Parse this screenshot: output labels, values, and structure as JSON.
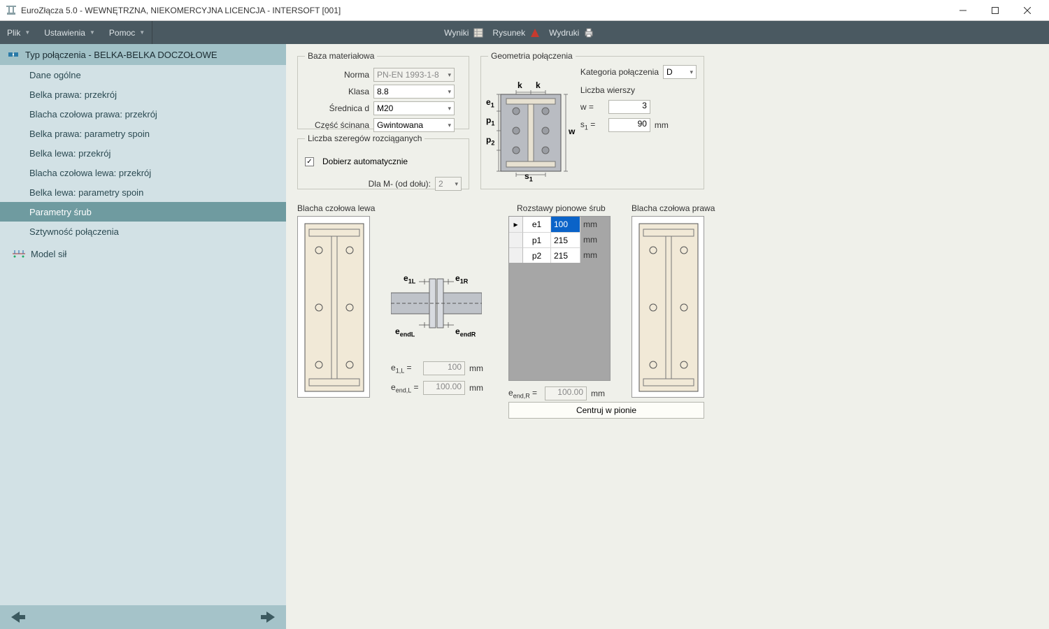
{
  "window": {
    "title": "EuroZłącza 5.0 - WEWNĘTRZNA, NIEKOMERCYJNA LICENCJA - INTERSOFT [001]"
  },
  "menu": {
    "plik": "Plik",
    "ustawienia": "Ustawienia",
    "pomoc": "Pomoc"
  },
  "toolbar": {
    "wyniki": "Wyniki",
    "rysunek": "Rysunek",
    "wydruki": "Wydruki"
  },
  "sidebar": {
    "header": "Typ połączenia - BELKA-BELKA DOCZOŁOWE",
    "items": [
      "Dane ogólne",
      "Belka prawa: przekrój",
      "Blacha czołowa prawa: przekrój",
      "Belka prawa: parametry spoin",
      "Belka lewa: przekrój",
      "Blacha czołowa lewa: przekrój",
      "Belka lewa: parametry spoin",
      "Parametry śrub",
      "Sztywność połączenia"
    ],
    "model": "Model sił"
  },
  "groups": {
    "baza": {
      "legend": "Baza materiałowa",
      "norma_lbl": "Norma",
      "norma_val": "PN-EN 1993-1-8",
      "klasa_lbl": "Klasa",
      "klasa_val": "8.8",
      "srednica_lbl": "Średnica d",
      "srednica_val": "M20",
      "czesc_lbl": "Część ścinana",
      "czesc_val": "Gwintowana"
    },
    "szeregi": {
      "legend": "Liczba szeregów rozciąganych",
      "auto_lbl": "Dobierz automatycznie",
      "dlam_lbl": "Dla M- (od dołu):",
      "dlam_val": "2"
    },
    "geom": {
      "legend": "Geometria połączenia",
      "kategoria_lbl": "Kategoria połączenia",
      "kategoria_val": "D",
      "wierszy_lbl": "Liczba  wierszy",
      "w_lbl": "w   =",
      "w_val": "3",
      "s1_lbl_pre": "s",
      "s1_lbl_post": "   =",
      "s1_val": "90",
      "s1_unit": "mm"
    }
  },
  "labels": {
    "blacha_lewa": "Blacha czołowa lewa",
    "blacha_prawa": "Blacha czołowa prawa",
    "rozstawy": "Rozstawy pionowe śrub",
    "centruj": "Centruj w pionie",
    "mm": "mm"
  },
  "grid": {
    "rows": [
      {
        "name": "e1",
        "val": "100",
        "unit": "mm",
        "sel": true
      },
      {
        "name": "p1",
        "val": "215",
        "unit": "mm",
        "sel": false
      },
      {
        "name": "p2",
        "val": "215",
        "unit": "mm",
        "sel": false
      }
    ]
  },
  "bottom": {
    "e1L_lbl_pre": "e",
    "e1L_lbl_post": "   =",
    "e1L_val": "100",
    "eendL_lbl_pre": "e",
    "eendL_lbl_post": " =",
    "eendL_val": "100.00",
    "eendR_lbl_pre": "e",
    "eendR_lbl_post": " =",
    "eendR_val": "100.00"
  },
  "diag": {
    "k1": "k",
    "k2": "k",
    "w": "w",
    "e1": "e",
    "p1": "p",
    "p2": "p",
    "s1": "s",
    "e1L": "e",
    "e1R": "e",
    "eendL": "e",
    "eendR": "e"
  }
}
